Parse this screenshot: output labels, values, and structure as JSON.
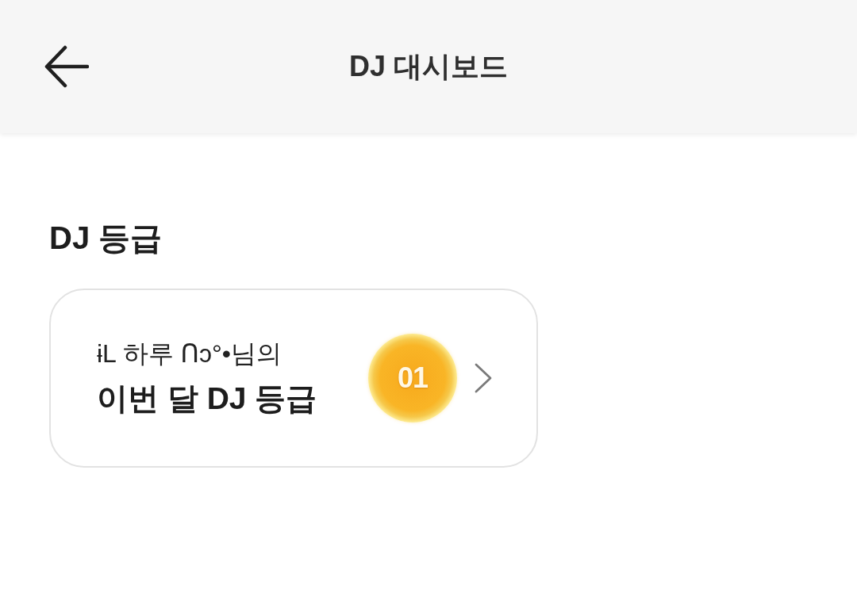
{
  "header": {
    "title": "DJ 대시보드"
  },
  "grade_section": {
    "title": "DJ 등급",
    "card": {
      "subtitle": "ɨL 하루 ᑎɔ°•님의",
      "title": "이번 달 DJ 등급",
      "rank": "01"
    }
  }
}
